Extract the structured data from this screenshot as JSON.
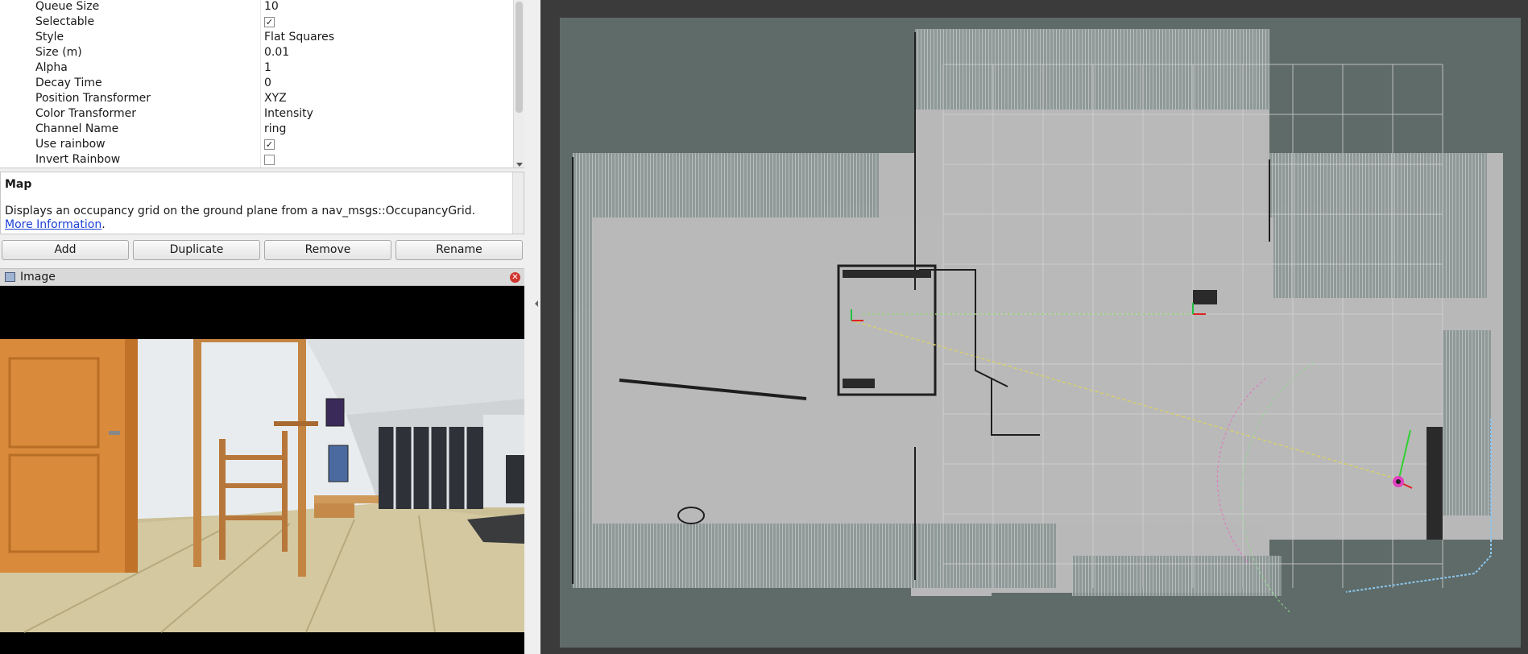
{
  "properties": [
    {
      "name": "Queue Size",
      "value": "10"
    },
    {
      "name": "Selectable",
      "value": "✓",
      "checkbox": true
    },
    {
      "name": "Style",
      "value": "Flat Squares"
    },
    {
      "name": "Size (m)",
      "value": "0.01"
    },
    {
      "name": "Alpha",
      "value": "1"
    },
    {
      "name": "Decay Time",
      "value": "0"
    },
    {
      "name": "Position Transformer",
      "value": "XYZ"
    },
    {
      "name": "Color Transformer",
      "value": "Intensity"
    },
    {
      "name": "Channel Name",
      "value": "ring"
    },
    {
      "name": "Use rainbow",
      "value": "✓",
      "checkbox": true
    },
    {
      "name": "Invert Rainbow",
      "value": "",
      "checkbox": true
    }
  ],
  "description": {
    "title": "Map",
    "text": "Displays an occupancy grid on the ground plane from a nav_msgs::OccupancyGrid.",
    "link_text": "More Information",
    "trailing": "."
  },
  "buttons": {
    "add": "Add",
    "duplicate": "Duplicate",
    "remove": "Remove",
    "rename": "Rename"
  },
  "image_panel": {
    "title": "Image",
    "close_icon": "close-icon",
    "window_icon": "window-icon"
  },
  "colors": {
    "map_background": "#5f6b68",
    "map_free": "#b7b7b7",
    "grid_line": "#cfcfcf",
    "viewport_border": "#3b3b3b"
  }
}
